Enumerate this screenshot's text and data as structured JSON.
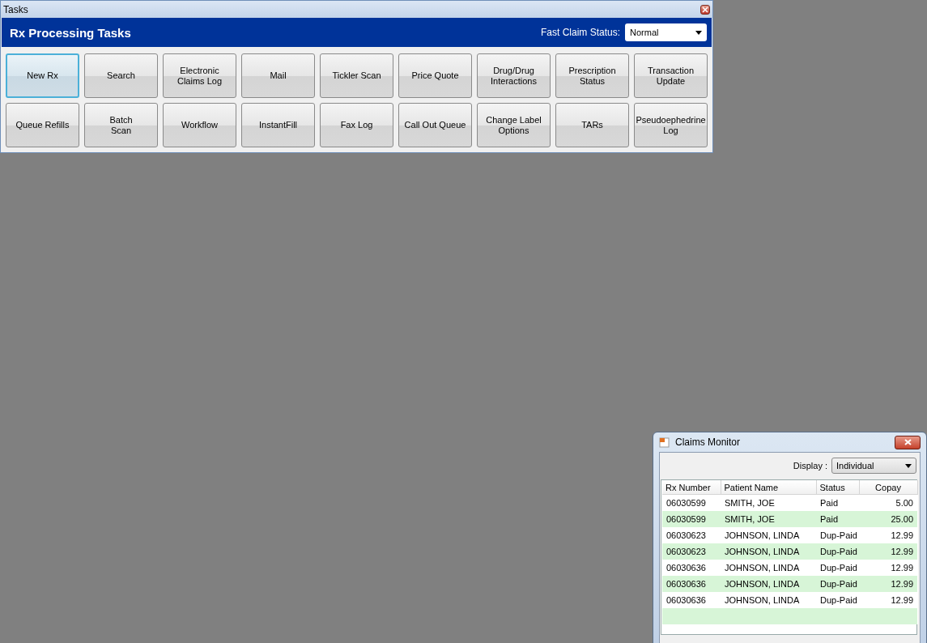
{
  "tasks_window": {
    "title": "Tasks",
    "heading": "Rx Processing Tasks",
    "fast_claim_status": {
      "label": "Fast Claim Status:",
      "value": "Normal"
    },
    "buttons": [
      {
        "label": "New Rx",
        "selected": true
      },
      {
        "label": "Search",
        "selected": false
      },
      {
        "label": "Electronic\nClaims Log",
        "selected": false
      },
      {
        "label": "Mail",
        "selected": false
      },
      {
        "label": "Tickler Scan",
        "selected": false
      },
      {
        "label": "Price Quote",
        "selected": false
      },
      {
        "label": "Drug/Drug\nInteractions",
        "selected": false
      },
      {
        "label": "Prescription\nStatus",
        "selected": false
      },
      {
        "label": "Transaction\nUpdate",
        "selected": false
      },
      {
        "label": "Queue Refills",
        "selected": false
      },
      {
        "label": "Batch\nScan",
        "selected": false
      },
      {
        "label": "Workflow",
        "selected": false
      },
      {
        "label": "InstantFill",
        "selected": false
      },
      {
        "label": "Fax Log",
        "selected": false
      },
      {
        "label": "Call Out Queue",
        "selected": false
      },
      {
        "label": "Change Label\nOptions",
        "selected": false
      },
      {
        "label": "TARs",
        "selected": false
      },
      {
        "label": "Pseudoephedrine\nLog",
        "selected": false
      }
    ]
  },
  "claims_monitor": {
    "title": "Claims Monitor",
    "display": {
      "label": "Display :",
      "value": "Individual"
    },
    "columns": [
      "Rx Number",
      "Patient Name",
      "Status",
      "Copay"
    ],
    "rows": [
      [
        "06030599",
        "SMITH, JOE",
        "Paid",
        "5.00"
      ],
      [
        "06030599",
        "SMITH, JOE",
        "Paid",
        "25.00"
      ],
      [
        "06030623",
        "JOHNSON, LINDA",
        "Dup-Paid",
        "12.99"
      ],
      [
        "06030623",
        "JOHNSON, LINDA",
        "Dup-Paid",
        "12.99"
      ],
      [
        "06030636",
        "JOHNSON, LINDA",
        "Dup-Paid",
        "12.99"
      ],
      [
        "06030636",
        "JOHNSON, LINDA",
        "Dup-Paid",
        "12.99"
      ],
      [
        "06030636",
        "JOHNSON, LINDA",
        "Dup-Paid",
        "12.99"
      ]
    ]
  }
}
